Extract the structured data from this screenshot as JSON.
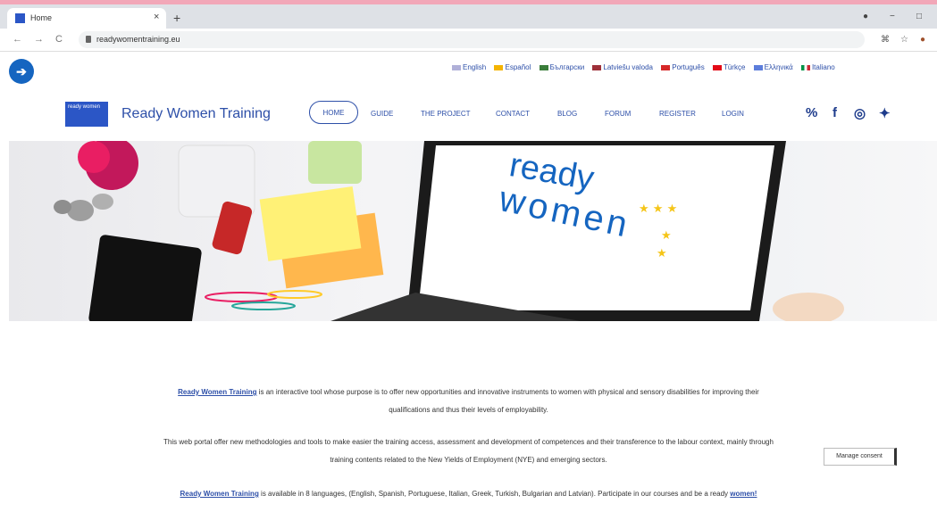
{
  "browser": {
    "tab_title": "Home",
    "tab_close": "×",
    "new_tab": "+",
    "url": "readywomentraining.eu",
    "back": "←",
    "forward": "→",
    "reload": "C",
    "win_min": "−",
    "win_max": "□"
  },
  "site": {
    "title": "Ready Women Training",
    "logo_text": "ready women",
    "accessibility_icon": "accessibility-icon",
    "languages": [
      "English",
      "Español",
      "Български",
      "Latviešu valoda",
      "Português",
      "Türkçe",
      "Ελληνικά",
      "Italiano"
    ],
    "menu": {
      "home": "HOME",
      "guide": "GUIDE",
      "project": "THE PROJECT",
      "contact": "CONTACT",
      "blog": "BLOG",
      "forum": "FORUM",
      "register": "REGISTER",
      "login": "LOGIN"
    },
    "social_icons": [
      "share-icon",
      "facebook-icon",
      "instagram-icon",
      "twitter-icon"
    ]
  },
  "hero": {
    "brand_line1": "ready",
    "brand_line2": "women"
  },
  "content": {
    "p1_link": "Ready Women Training",
    "p1_text": " is an interactive tool whose purpose is to offer new opportunities and innovative instruments to women with physical and sensory disabilities for improving their",
    "p1_text2": "qualifications and thus their levels of employability.",
    "p2_text": "This web portal offer new methodologies and tools to make easier the training access, assessment and development of competences and their transference to the labour context, mainly through",
    "p2_text2": "training contents related to the New Yields of Employment (NYE) and emerging sectors.",
    "p3_link": "Ready Women Training",
    "p3_text": " is available in 8 languages, (English, Spanish, Portuguese, Italian, Greek, Turkish, Bulgarian and Latvian). Participate in our courses and be a ready ",
    "p3_link2": "women!"
  },
  "consent": {
    "label": "Manage consent"
  },
  "colors": {
    "brand_blue": "#2d4fa8",
    "accent_yellow": "#f5c518",
    "pink": "#e84c77"
  }
}
